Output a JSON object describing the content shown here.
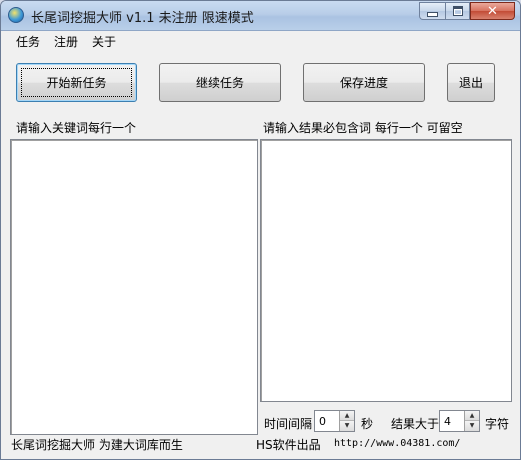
{
  "window": {
    "title": "长尾词挖掘大师 v1.1  未注册  限速模式",
    "close_glyph": "✕"
  },
  "menu": {
    "items": [
      "任务",
      "注册",
      "关于"
    ]
  },
  "toolbar": {
    "start_label": "开始新任务",
    "continue_label": "继续任务",
    "save_label": "保存进度",
    "exit_label": "退出"
  },
  "left_panel": {
    "label": "请输入关键词每行一个",
    "value": ""
  },
  "right_panel": {
    "label": "请输入结果必包含词  每行一个  可留空",
    "value": ""
  },
  "options": {
    "interval_label": "时间间隔",
    "interval_value": "0",
    "interval_unit": "秒",
    "result_label": "结果大于",
    "result_value": "4",
    "result_unit": "字符"
  },
  "status": {
    "left_text": "长尾词挖掘大师  为建大词库而生",
    "vendor": "HS软件出品",
    "url": "http://www.04381.com/"
  }
}
